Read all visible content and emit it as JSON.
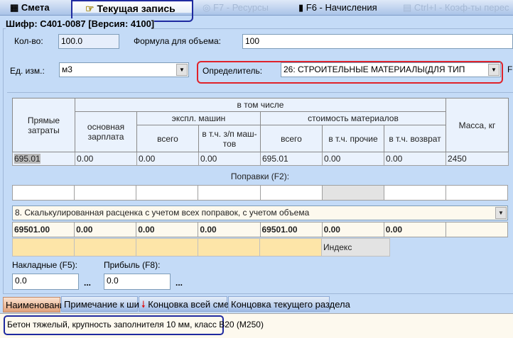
{
  "tabs": [
    {
      "label": "Смета",
      "icon": "calendar-grid-icon"
    },
    {
      "label": "Текущая запись",
      "icon": "pointing-hand-icon"
    },
    {
      "label": "F7 - Ресурсы",
      "icon": "resources-icon"
    },
    {
      "label": "F6 - Начисления",
      "icon": "calculator-icon"
    },
    {
      "label": "Ctrl+I - Коэф-ты перес",
      "icon": "document-icon"
    }
  ],
  "shifr": "Шифр: С401-0087  [Версия: 4100]",
  "qty": {
    "label": "Кол-во:",
    "value": "100.0"
  },
  "formula": {
    "label": "Формула для объема:",
    "value": "100"
  },
  "unit": {
    "label": "Ед. изм.:",
    "value": "м3"
  },
  "determinant": {
    "label": "Определитель:",
    "value": "26: СТРОИТЕЛЬНЫЕ МАТЕРИАЛЫ(ДЛЯ ТИП",
    "extra": "F"
  },
  "table": {
    "direct": "Прямые затраты",
    "incl": "в том числе",
    "mass": "Масса, кг",
    "wage": "основная зарплата",
    "machines": "экспл. машин",
    "materials": "стоимость материалов",
    "m_all": "всего",
    "m_wage": "в т.ч. з/п маш-тов",
    "mat_all": "всего",
    "mat_other": "в т.ч. прочие",
    "mat_return": "в т.ч. возврат",
    "values": [
      "695.01",
      "0.00",
      "0.00",
      "0.00",
      "695.01",
      "0.00",
      "0.00",
      "2450"
    ]
  },
  "corrections_label": "Поправки (F2):",
  "calc_select": "8. Скалькулированная расценка с учетом всех поправок, с учетом объема",
  "totals": [
    "69501.00",
    "0.00",
    "0.00",
    "0.00",
    "69501.00",
    "0.00",
    "0.00",
    ""
  ],
  "index_label": "Индекс",
  "overhead": {
    "label": "Накладные (F5):",
    "value": "0.0",
    "more": "..."
  },
  "profit": {
    "label": "Прибыль (F8):",
    "value": "0.0",
    "more": "..."
  },
  "bottom_tabs": [
    "Наименование",
    "Примечание к шифру",
    "Концовка всей сметы",
    "Концовка текущего раздела"
  ],
  "name_text": "Бетон тяжелый, крупность заполнителя 10 мм, класс В20 (М250)"
}
